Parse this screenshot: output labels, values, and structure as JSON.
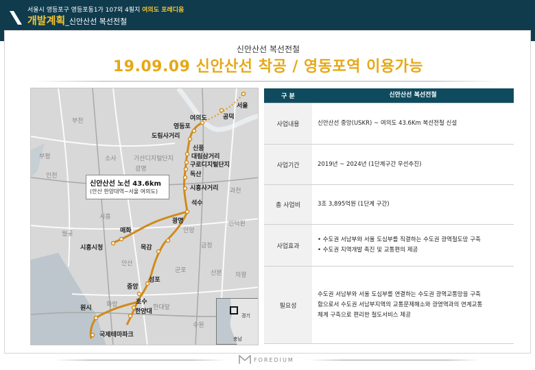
{
  "header": {
    "address": "서울시 영등포구 영등포동1가 107외 4필지",
    "address_highlight": "여의도 포레디움",
    "title": "개발계획",
    "subtitle": "_신안산선 복선전철"
  },
  "content": {
    "kicker": "신안산선 복선전철",
    "headline": "19.09.09 신안산선 착공 / 영동포역 이용가능"
  },
  "map": {
    "callout_line1": "신안산선 노선 43.6km",
    "callout_line2": "(안산 한양대역~서울 여의도)",
    "stations": [
      "서울",
      "공덕",
      "여의도",
      "영등포",
      "도림사거리",
      "신풍",
      "대림삼거리",
      "구로디지털단지",
      "독산",
      "시흥사거리",
      "석수",
      "광명",
      "매화",
      "시흥시청",
      "목감",
      "성포",
      "중앙",
      "호수",
      "한양대",
      "원시",
      "국제테마파크"
    ],
    "regions": [
      "부천",
      "소사",
      "가산디지털단지",
      "광명",
      "인천",
      "과천",
      "부평",
      "인덕원",
      "시흥",
      "월곶",
      "안양",
      "금정",
      "산본",
      "안산",
      "군포",
      "의왕",
      "수원",
      "화랑",
      "한대앞",
      "경기",
      "충남"
    ]
  },
  "table": {
    "head_key": "구  분",
    "head_value": "신안산선 복선전철",
    "rows": [
      {
        "key": "사업내용",
        "lines": [
          "신안산선 중앙(USKR) ~ 여의도 43.6Km 복선전철 신설"
        ]
      },
      {
        "key": "사업기간",
        "lines": [
          "2019년 ~ 2024년 (1단계구간 우선추진)"
        ]
      },
      {
        "key": "총 사업비",
        "lines": [
          "3조 3,895억원 (1단계 구간)"
        ]
      },
      {
        "key": "사업효과",
        "lines": [
          "• 수도권 서남부와 서울 도심부를 직결하는 수도권 광역철도망 구축",
          "• 수도권 지역개발 촉진 및 교통편의 제공"
        ]
      },
      {
        "key": "필요성",
        "lines": [
          "수도권 서남부와 서울 도심부를 연결하는 수도권 광역교통망을 구축",
          "함으로서 수도권 서남부지역의 교통문제해소와 광명역과의 연계교통",
          "체계 구축으로 편리한 철도서비스 제공"
        ]
      }
    ]
  },
  "footer": {
    "brand": "FOREDIUM"
  },
  "colors": {
    "header_bg": "#0f3b4d",
    "accent_yellow": "#f3c431",
    "headline_orange": "#e6a817",
    "route_line": "#d08a1a",
    "table_head": "#0f4b5e"
  }
}
